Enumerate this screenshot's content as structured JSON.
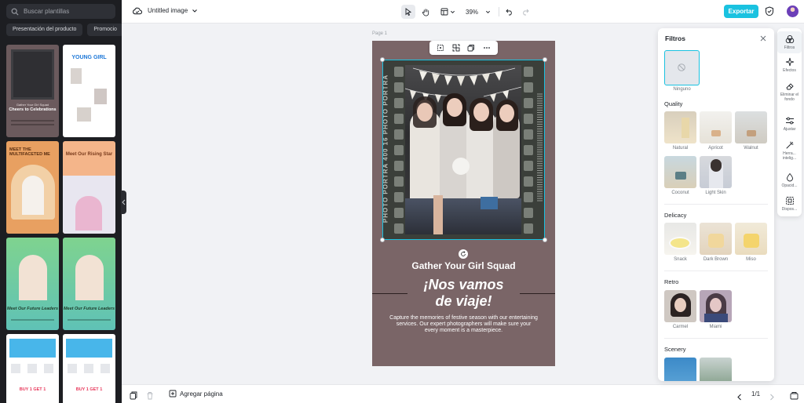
{
  "left_panel": {
    "search_placeholder": "Buscar plantillas",
    "chips": [
      "Presentación del producto",
      "Promocio"
    ],
    "templates": [
      {
        "title": "Cheers to Celebrations",
        "subtitle": "Gather Your Girl Squad"
      },
      {
        "title": "YOUNG GIRL",
        "subtitle": ""
      },
      {
        "title": "MEET THE MULTIFACETED ME",
        "subtitle": ""
      },
      {
        "title": "Meet Our Rising Star",
        "subtitle": ""
      },
      {
        "title": "Meet Our Future Leaders",
        "subtitle": ""
      },
      {
        "title": "Meet Our Future Leaders",
        "subtitle": ""
      },
      {
        "title": "BUY 1 GET 1",
        "subtitle": ""
      },
      {
        "title": "BUY 1 GET 1",
        "subtitle": ""
      }
    ]
  },
  "topbar": {
    "doc_title": "Untitled image",
    "zoom": "39%",
    "export_label": "Exportar"
  },
  "canvas": {
    "page_label": "Page 1",
    "film_text": "PHOTO PORTRA 400 16 PHOTO PORTRA",
    "line1": "Gather Your Girl Squad",
    "heading_1": "¡Nos vamos",
    "heading_2": "de viaje!",
    "body": "Capture the memories of festive season with our entertaining services. Our expert photographers will make sure your every moment is a masterpiece."
  },
  "bottombar": {
    "add_page_label": "Agregar página",
    "page_count": "1/1"
  },
  "filters": {
    "title": "Filtros",
    "none_label": "Ninguno",
    "sections": [
      {
        "name": "Quality",
        "items": [
          "Natural",
          "Apricot",
          "Walnut",
          "Coconut",
          "Light Skin"
        ]
      },
      {
        "name": "Delicacy",
        "items": [
          "Snack",
          "Dark Brown",
          "Miso"
        ]
      },
      {
        "name": "Retro",
        "items": [
          "Carmel",
          "Miami"
        ]
      },
      {
        "name": "Scenery",
        "items": []
      }
    ]
  },
  "rail": {
    "items": [
      "Filtros",
      "Efectos",
      "Eliminar el fondo",
      "Ajustar",
      "Herra... intelig...",
      "Opacid...",
      "Dispos..."
    ]
  },
  "colors": {
    "accent": "#1ac2e0",
    "page_bg": "#7a6567",
    "sidebar_bg": "#1d1e22"
  }
}
